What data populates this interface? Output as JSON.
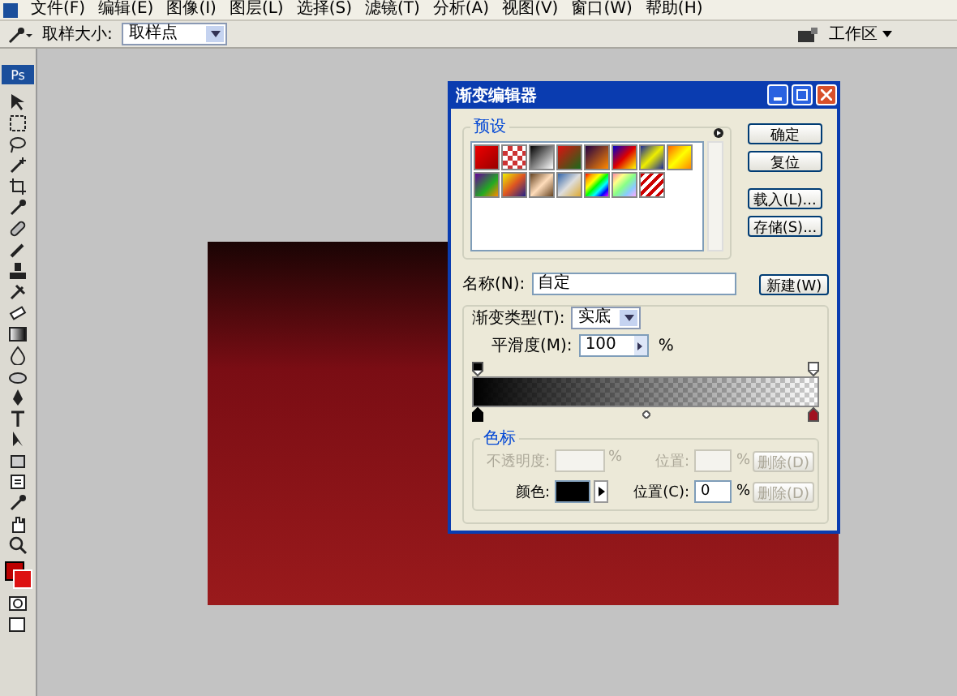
{
  "menu_bar": [
    "文件(F)",
    "编辑(E)",
    "图像(I)",
    "图层(L)",
    "选择(S)",
    "滤镜(T)",
    "分析(A)",
    "视图(V)",
    "窗口(W)",
    "帮助(H)"
  ],
  "options_bar": {
    "sample_size_label": "取样大小:",
    "sample_size_value": "取样点",
    "workspace": "工作区"
  },
  "toolbox": {
    "logo": "Ps"
  },
  "dialog": {
    "title": "渐变编辑器",
    "presets_label": "预设",
    "buttons": [
      "确定",
      "复位",
      "载入(L)...",
      "存储(S)..."
    ],
    "name_label": "名称(N):",
    "name_value": "自定",
    "new_button": "新建(W)",
    "type_label": "渐变类型(T):",
    "type_value": "实底",
    "smoothness_label": "平滑度(M):",
    "smoothness_value": "100",
    "smoothness_unit": "%",
    "stops_label": "色标",
    "stop_rows": [
      {
        "kind": "opacity",
        "label": "不透明度:",
        "unit": "%",
        "position_label": "位置:",
        "position_value": "",
        "position_unit": "%",
        "delete": "删除(D)",
        "disabled": true,
        "delete_disabled": true
      },
      {
        "kind": "color",
        "label": "颜色:",
        "position_label": "位置(C):",
        "position_value": "0",
        "position_unit": "%",
        "delete": "删除(D)",
        "disabled": false,
        "delete_disabled": true
      }
    ]
  }
}
